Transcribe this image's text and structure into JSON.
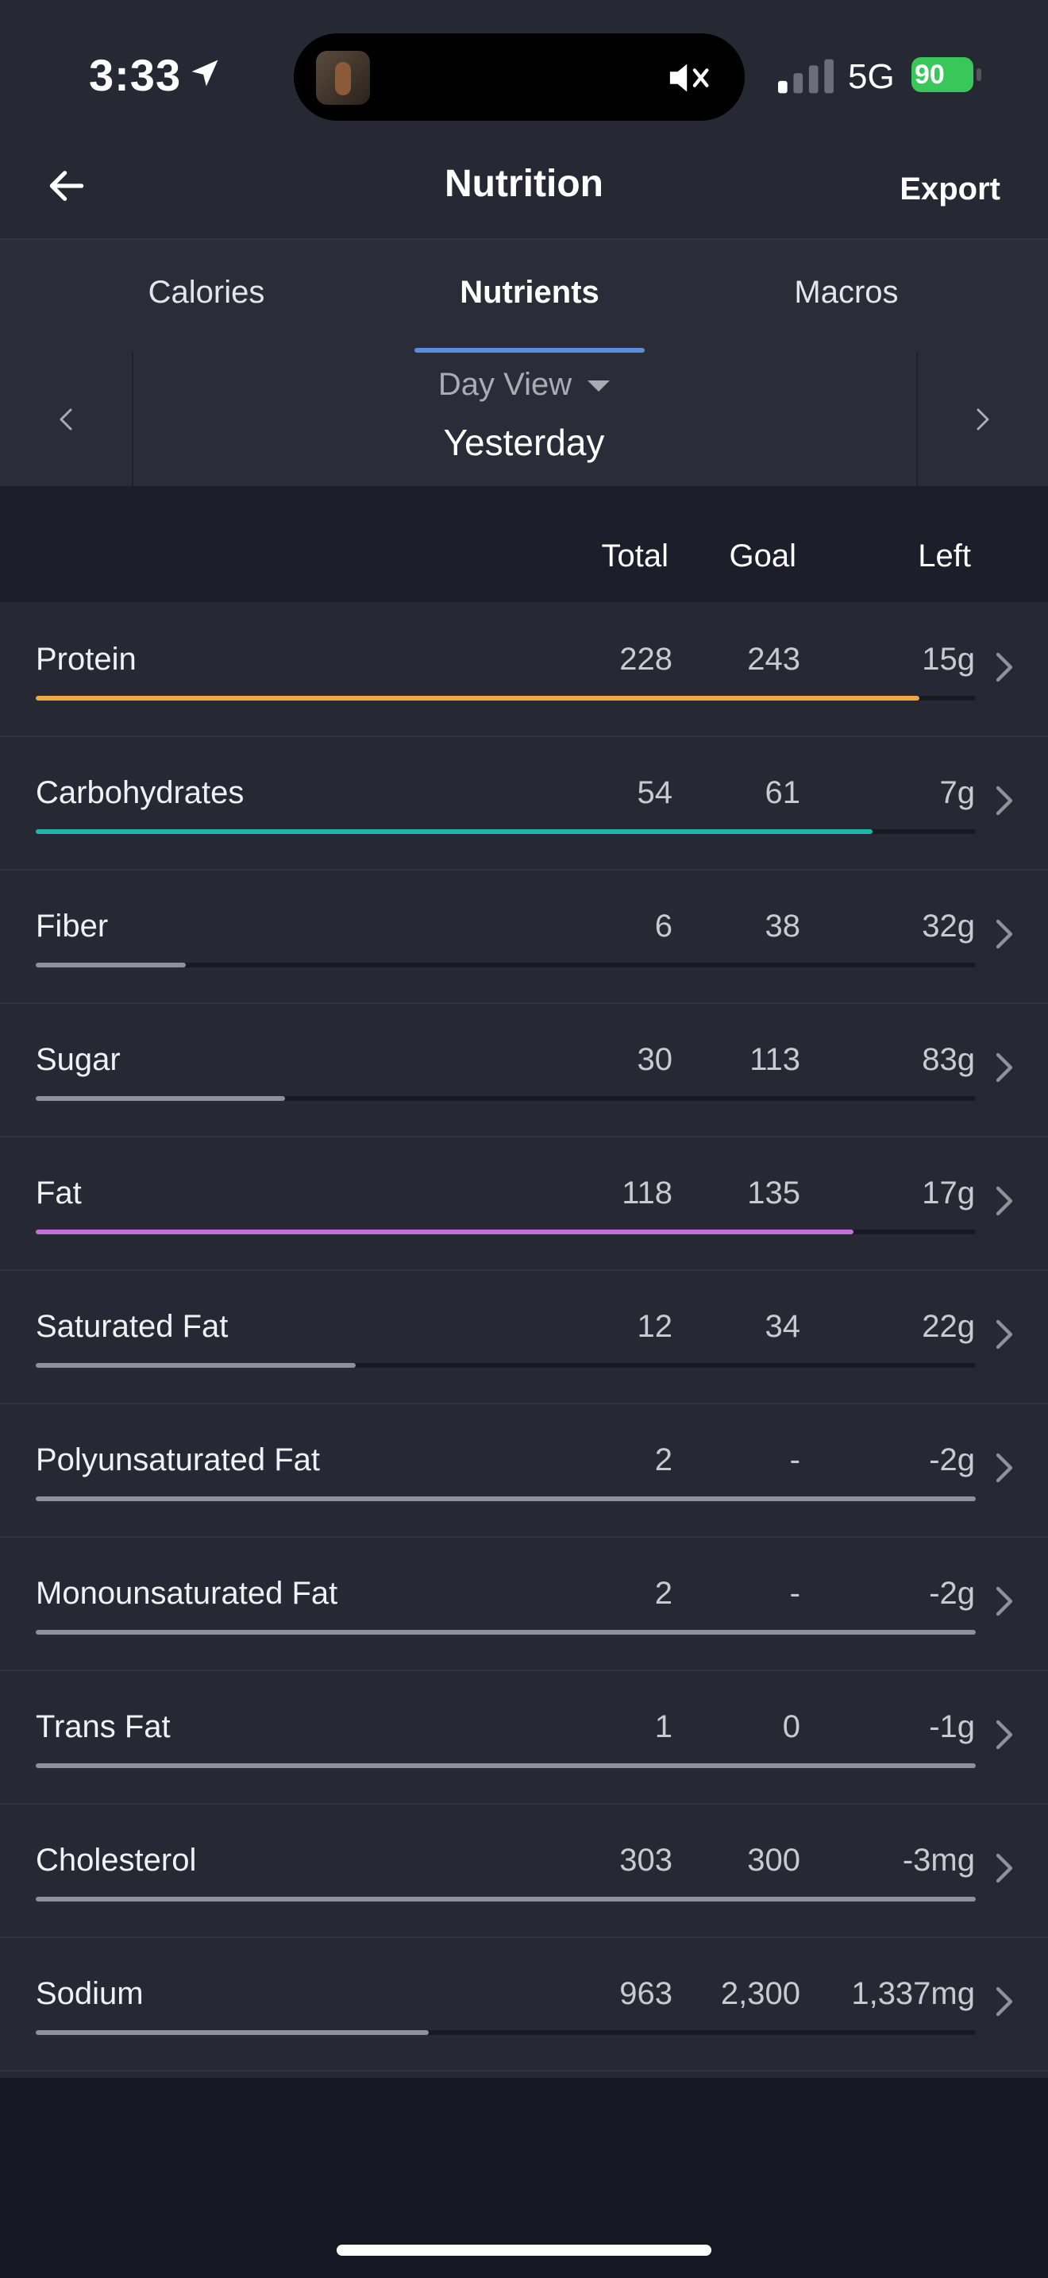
{
  "status_bar": {
    "time": "3:33",
    "network": "5G",
    "battery": "90"
  },
  "nav": {
    "title": "Nutrition",
    "export_label": "Export"
  },
  "tabs": [
    {
      "label": "Calories",
      "active": false
    },
    {
      "label": "Nutrients",
      "active": true
    },
    {
      "label": "Macros",
      "active": false
    }
  ],
  "day_selector": {
    "mode": "Day View",
    "date_label": "Yesterday"
  },
  "table": {
    "headers": {
      "total": "Total",
      "goal": "Goal",
      "left": "Left"
    },
    "rows": [
      {
        "name": "Protein",
        "total": "228",
        "goal": "243",
        "left": "15g",
        "progress": 0.94,
        "color": "#f0a73e"
      },
      {
        "name": "Carbohydrates",
        "total": "54",
        "goal": "61",
        "left": "7g",
        "progress": 0.89,
        "color": "#1fb8a8"
      },
      {
        "name": "Fiber",
        "total": "6",
        "goal": "38",
        "left": "32g",
        "progress": 0.16,
        "color": "#8e909a"
      },
      {
        "name": "Sugar",
        "total": "30",
        "goal": "113",
        "left": "83g",
        "progress": 0.265,
        "color": "#8e909a"
      },
      {
        "name": "Fat",
        "total": "118",
        "goal": "135",
        "left": "17g",
        "progress": 0.87,
        "color": "#c56fd8"
      },
      {
        "name": "Saturated Fat",
        "total": "12",
        "goal": "34",
        "left": "22g",
        "progress": 0.34,
        "color": "#8e909a"
      },
      {
        "name": "Polyunsaturated Fat",
        "total": "2",
        "goal": "-",
        "left": "-2g",
        "progress": 1.0,
        "color": "#8e909a"
      },
      {
        "name": "Monounsaturated Fat",
        "total": "2",
        "goal": "-",
        "left": "-2g",
        "progress": 1.0,
        "color": "#8e909a"
      },
      {
        "name": "Trans Fat",
        "total": "1",
        "goal": "0",
        "left": "-1g",
        "progress": 1.0,
        "color": "#8e909a"
      },
      {
        "name": "Cholesterol",
        "total": "303",
        "goal": "300",
        "left": "-3mg",
        "progress": 1.0,
        "color": "#8e909a"
      },
      {
        "name": "Sodium",
        "total": "963",
        "goal": "2,300",
        "left": "1,337mg",
        "progress": 0.418,
        "color": "#8e909a"
      }
    ]
  }
}
